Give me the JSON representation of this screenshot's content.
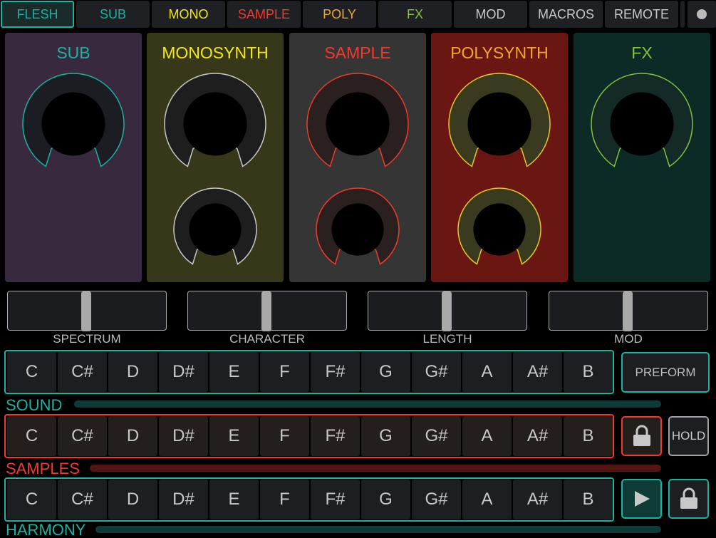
{
  "tabs": [
    {
      "label": "FLESH",
      "color": "#19b3a2"
    },
    {
      "label": "SUB",
      "color": "#19b3a2"
    },
    {
      "label": "MONO",
      "color": "#f2e81c"
    },
    {
      "label": "SAMPLE",
      "color": "#f23a2c"
    },
    {
      "label": "POLY",
      "color": "#f2a72c"
    },
    {
      "label": "FX",
      "color": "#82c23c"
    },
    {
      "label": "MOD",
      "color": "#c8c8c8"
    },
    {
      "label": "MACROS",
      "color": "#c8c8c8"
    },
    {
      "label": "REMOTE",
      "color": "#c8c8c8"
    }
  ],
  "active_tab": "FLESH",
  "panels": [
    {
      "title": "SUB",
      "title_color": "#19b3a2",
      "bg": "#38293f",
      "ring": "#19b3a2"
    },
    {
      "title": "MONOSYNTH",
      "title_color": "#f2e81c",
      "bg": "#37371a",
      "ring": "#c8c8c8"
    },
    {
      "title": "SAMPLE",
      "title_color": "#f23a2c",
      "bg": "#353535",
      "ring": "#f23a2c"
    },
    {
      "title": "POLYSYNTH",
      "title_color": "#f2a72c",
      "bg": "#6a1714",
      "ring": "#e6c62c"
    },
    {
      "title": "FX",
      "title_color": "#82c23c",
      "bg": "#0c2a26",
      "ring": "#82c23c"
    }
  ],
  "sliders": [
    {
      "label": "SPECTRUM",
      "value": 0.5
    },
    {
      "label": "CHARACTER",
      "value": 0.5
    },
    {
      "label": "LENGTH",
      "value": 0.5
    },
    {
      "label": "MOD",
      "value": 0.5
    }
  ],
  "notes": [
    "C",
    "C#",
    "D",
    "D#",
    "E",
    "F",
    "F#",
    "G",
    "G#",
    "A",
    "A#",
    "B"
  ],
  "keyboards": {
    "sound": {
      "label": "SOUND",
      "color": "#19b3a2",
      "key_bg": "#1c1e22",
      "bar": "#0e3b36"
    },
    "samples": {
      "label": "SAMPLES",
      "color": "#f23a2c",
      "key_bg": "#241e1d",
      "bar": "#551412"
    },
    "harmony": {
      "label": "HARMONY",
      "color": "#19b3a2",
      "key_bg": "#1c1e22",
      "bar": "#0e3b36"
    }
  },
  "buttons": {
    "preform": "PREFORM",
    "hold": "HOLD",
    "play_icon": "play-icon",
    "lock_icon": "lock-icon",
    "record_icon": "record-dot-icon"
  }
}
